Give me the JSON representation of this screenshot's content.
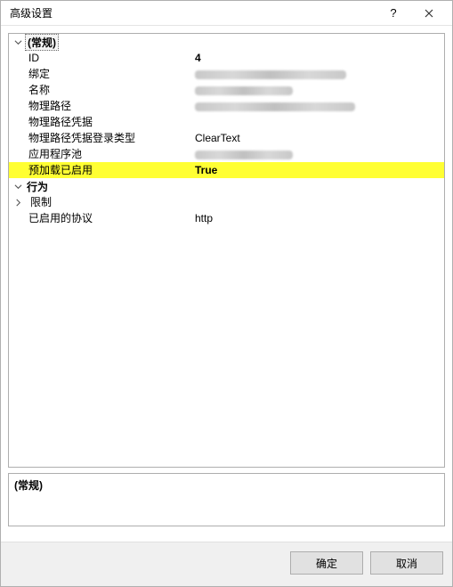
{
  "titlebar": {
    "title": "高级设置",
    "help_label": "?",
    "close_label": "×"
  },
  "groups": {
    "general": {
      "header": "(常规)"
    },
    "behavior": {
      "header": "行为"
    }
  },
  "rows": {
    "id": {
      "label": "ID",
      "value": "4"
    },
    "binding": {
      "label": "绑定",
      "value": ""
    },
    "name": {
      "label": "名称",
      "value": ""
    },
    "phys_path": {
      "label": "物理路径",
      "value": ""
    },
    "phys_cred": {
      "label": "物理路径凭据",
      "value": ""
    },
    "phys_logon": {
      "label": "物理路径凭据登录类型",
      "value": "ClearText"
    },
    "app_pool": {
      "label": "应用程序池",
      "value": ""
    },
    "preload": {
      "label": "预加载已启用",
      "value": "True"
    },
    "limits": {
      "label": "限制",
      "value": ""
    },
    "protocols": {
      "label": "已启用的协议",
      "value": "http"
    }
  },
  "description": {
    "title": "(常规)"
  },
  "buttons": {
    "ok": "确定",
    "cancel": "取消"
  }
}
